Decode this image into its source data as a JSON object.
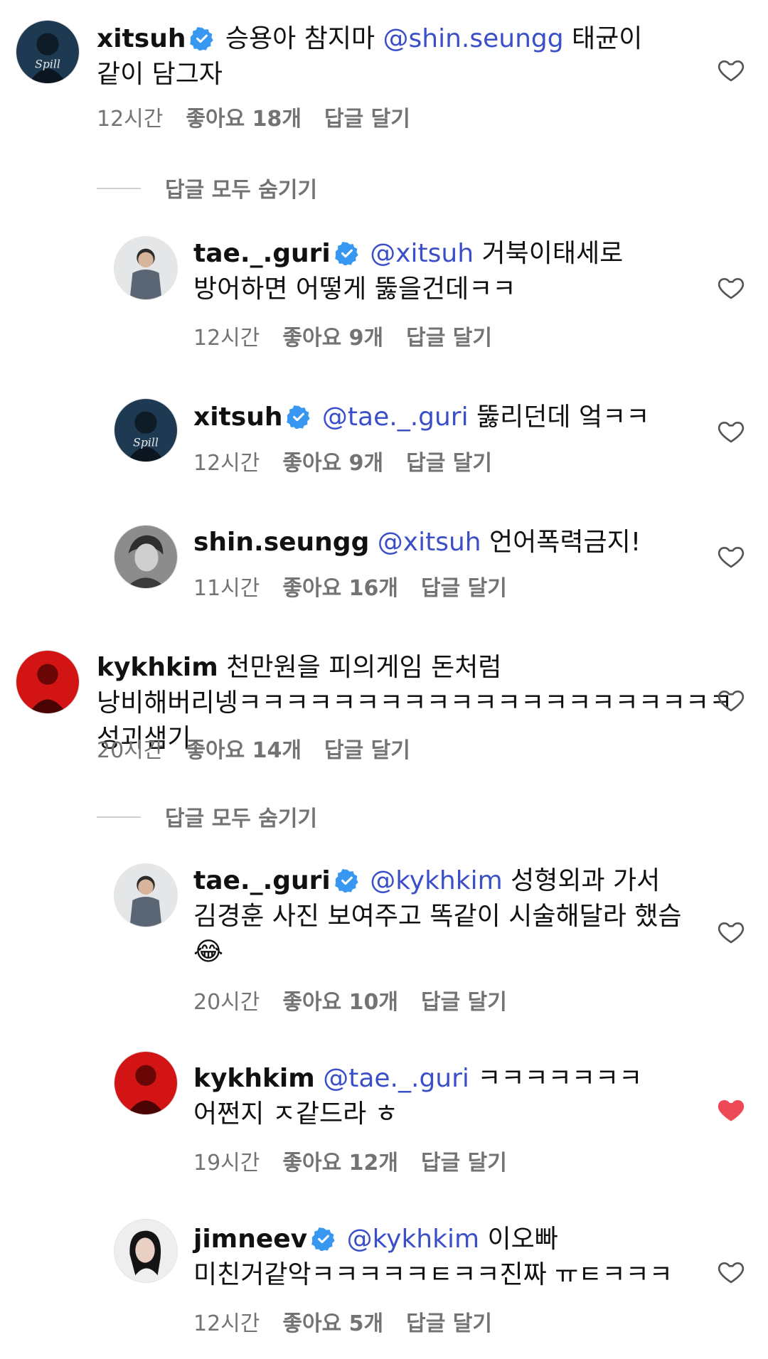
{
  "common": {
    "like_prefix": "좋아요 ",
    "like_suffix": "개",
    "reply_label": "답글 달기",
    "hide_replies_label": "답글 모두 숨기기"
  },
  "colors": {
    "mention": "#3b50c8",
    "meta_gray": "#737373",
    "liked_heart": "#ed4956",
    "verified": "#3897f0"
  },
  "comments": [
    {
      "username": "xitsuh",
      "verified": true,
      "mention": "",
      "text": "승용아 참지마 ",
      "mention2": "@shin.seungg",
      "text2": " 태균이 같이 담그자",
      "time": "12시간",
      "likes": "18",
      "liked": false
    },
    {
      "username": "tae._.guri",
      "verified": true,
      "mention": "@xitsuh",
      "text": " 거북이태세로 방어하면 어떻게 뚫을건데ㅋㅋ",
      "time": "12시간",
      "likes": "9",
      "liked": false
    },
    {
      "username": "xitsuh",
      "verified": true,
      "mention": "@tae._.guri",
      "text": " 뚫리던데 엌ㅋㅋ",
      "time": "12시간",
      "likes": "9",
      "liked": false
    },
    {
      "username": "shin.seungg",
      "verified": false,
      "mention": "@xitsuh",
      "text": " 언어폭력금지!",
      "time": "11시간",
      "likes": "16",
      "liked": false
    },
    {
      "username": "kykhkim",
      "verified": false,
      "mention": "",
      "text": " 천만원을 피의게임 돈처럼 낭비해버리넹ㅋㅋㅋㅋㅋㅋㅋㅋㅋㅋㅋㅋㅋㅋㅋㅋㅋㅋㅋㅋㅋ 성괴샘기",
      "time": "20시간",
      "likes": "14",
      "liked": false
    },
    {
      "username": "tae._.guri",
      "verified": true,
      "mention": "@kykhkim",
      "text": " 성형외과 가서 김경훈 사진 보여주고 똑같이 시술해달라 했슴",
      "emoji": "😂",
      "time": "20시간",
      "likes": "10",
      "liked": false
    },
    {
      "username": "kykhkim",
      "verified": false,
      "mention": "@tae._.guri",
      "text": " ㅋㅋㅋㅋㅋㅋㅋ 어쩐지 ㅈ같드라 ㅎ",
      "time": "19시간",
      "likes": "12",
      "liked": true
    },
    {
      "username": "jimneev",
      "verified": true,
      "mention": "@kykhkim",
      "text": " 이오빠 미친거같악ㅋㅋㅋㅋㅋㅌㅋㅋ진짜 ㅠㅌㅋㅋㅋ",
      "time": "12시간",
      "likes": "5",
      "liked": false
    }
  ],
  "avatar_texts": {
    "xitsuh": "Spill"
  }
}
